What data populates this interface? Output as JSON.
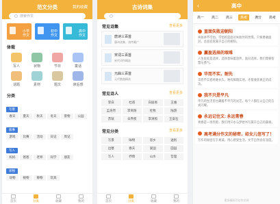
{
  "screen1": {
    "title": "范文分类",
    "right_action": "我的收藏",
    "search_placeholder": "搜索作文",
    "cards": [
      {
        "label": "小学\n作文",
        "color": "#f4a041"
      },
      {
        "label": "初中\n作文",
        "color": "#3f95f0"
      },
      {
        "label": "高中\n作文",
        "color": "#37b9d8"
      }
    ],
    "genre_title": "体裁",
    "genres": [
      {
        "label": "写人",
        "color": "#f3c46a"
      },
      {
        "label": "状物",
        "color": "#8fc7a6"
      },
      {
        "label": "节日",
        "color": "#f1a6a6"
      },
      {
        "label": "童话",
        "color": "#a9c4f5"
      },
      {
        "label": "话题",
        "color": "#f0c07b"
      },
      {
        "label": "素材",
        "color": "#9fd3d6"
      },
      {
        "label": "题文",
        "color": "#d9c79f"
      },
      {
        "label": "读后感",
        "color": "#9fb6e8"
      }
    ],
    "category_title": "分类",
    "categories": [
      {
        "tag": "写景",
        "items": [
          "春天",
          "夏天",
          "秋天",
          "冬天",
          "景物",
          "公园"
        ]
      },
      {
        "tag": "叙事",
        "items": [
          "游戏",
          "比赛",
          "活动",
          "日记",
          "周记"
        ]
      },
      {
        "tag": "写人",
        "items": [
          "妈妈",
          "爸爸",
          "老师",
          "同学",
          "朋友"
        ]
      },
      {
        "tag": "状物",
        "items": [
          "动物",
          "植物",
          "静物",
          "玩具"
        ]
      },
      {
        "tag": "抒情",
        "items": [
          "亲情",
          "友情",
          "感恩",
          "梦想"
        ]
      }
    ]
  },
  "screen2": {
    "title": "古诗词集",
    "rec_title": "常见诗集",
    "rec_more": "查看更多",
    "recs": [
      {
        "title": "唐诗三百首",
        "desc": "唐诗选集，流传最广"
      },
      {
        "title": "宋词三百首",
        "desc": "宋代词作精选"
      },
      {
        "title": "元曲三百首",
        "desc": "元代散曲精选"
      }
    ],
    "poets_title": "常见诗人",
    "poets_more": "查看更多",
    "poets": [
      "李白",
      "杜甫",
      "白居易",
      "王维",
      "孟浩然",
      "李商隐",
      "杜牧",
      "陆游",
      "苏轼",
      "辛弃疾",
      "李清照",
      "王安石"
    ],
    "cats_title": "常见分类",
    "cats_more": "查看更多",
    "cats": [
      "写景",
      "咏物",
      "思乡",
      "送别",
      "边塞",
      "春天",
      "爱国",
      "田园",
      "写人",
      "抒情",
      "山水",
      "哲理"
    ]
  },
  "screen3": {
    "back": "‹",
    "title": "高中",
    "grades": [
      "高一",
      "高二",
      "高三",
      "高考",
      "满分",
      "高考"
    ],
    "active_grade": 3,
    "articles": [
      {
        "title": "直面失败迎朝阳",
        "body": "失败并不可怕，可怕的是面对失败时的畏惧。只要勇敢面对，总会迎来属于自己的朝阳。"
      },
      {
        "title": "赢盈选择的艰难",
        "body": "人生处处是选择，选择意味着放弃。面对选择，我们需要智慧与勇气。"
      },
      {
        "title": "华而不实，耐先",
        "body": "华而不实者终难长久，唯有脚踏实地，才能收获真正的成功。"
      },
      {
        "title": "我不只是平凡",
        "body": "平凡的生活里也藏着不平凡的光芒，每个人都在以自己的方式闪耀。"
      },
      {
        "title": "永远记住文: 永远青春",
        "body": "青春是一场奔跑，我们用汗水与梦想书写属于自己的篇章。"
      },
      {
        "title": "高考满分作文的秘密，给女儿信写了！",
        "body": "写作的秘密在于真诚，用心感受生活，文字自然会有温度。"
      }
    ],
    "footer": "更多精彩尽在作文网"
  },
  "tabbar": [
    {
      "label": "首页",
      "active": false
    },
    {
      "label": "分类",
      "active": true
    },
    {
      "label": "收藏",
      "active": false
    },
    {
      "label": "我的",
      "active": false
    }
  ]
}
